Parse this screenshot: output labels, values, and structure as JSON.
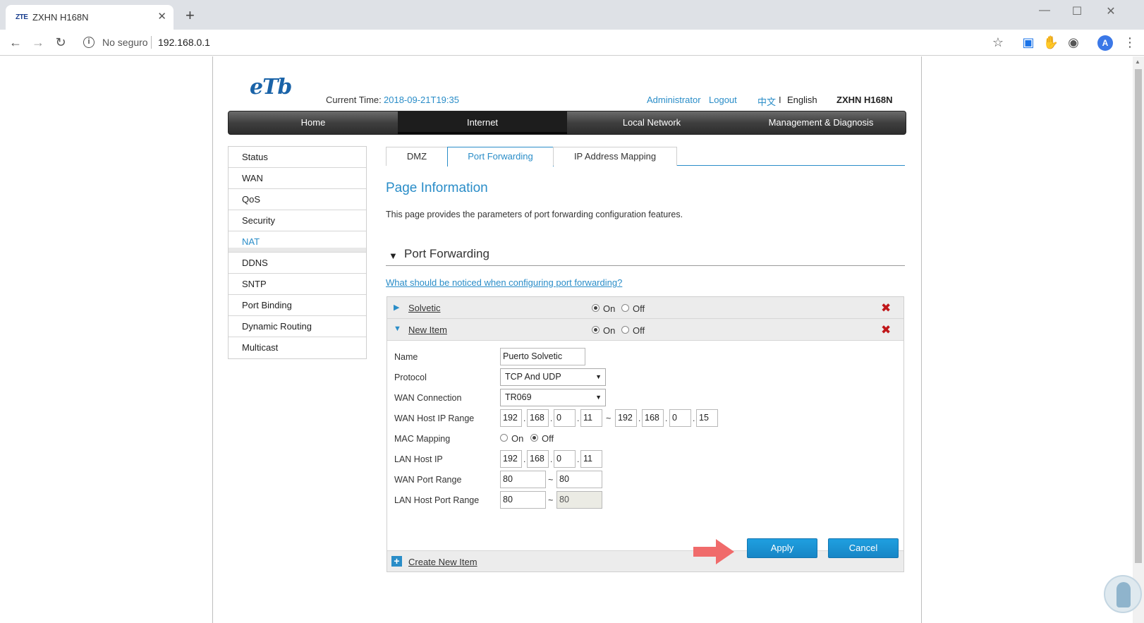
{
  "browser": {
    "tab_favicon": "ZTE",
    "tab_title": "ZXHN H168N",
    "not_secure": "No seguro",
    "url": "192.168.0.1",
    "avatar_letter": "A"
  },
  "header": {
    "logo_text": "eTb",
    "current_time_label": "Current Time:",
    "current_time_value": "2018-09-21T19:35",
    "admin_label": "Administrator",
    "logout_label": "Logout",
    "lang_cn": "中文",
    "lang_sep": "I",
    "lang_en": "English",
    "model": "ZXHN H168N"
  },
  "mainnav": [
    {
      "label": "Home"
    },
    {
      "label": "Internet"
    },
    {
      "label": "Local Network"
    },
    {
      "label": "Management & Diagnosis"
    }
  ],
  "sidemenu": [
    {
      "label": "Status"
    },
    {
      "label": "WAN"
    },
    {
      "label": "QoS"
    },
    {
      "label": "Security"
    },
    {
      "label": "NAT"
    },
    {
      "label": "DDNS"
    },
    {
      "label": "SNTP"
    },
    {
      "label": "Port Binding"
    },
    {
      "label": "Dynamic Routing"
    },
    {
      "label": "Multicast"
    }
  ],
  "subtabs": [
    {
      "label": "DMZ"
    },
    {
      "label": "Port Forwarding"
    },
    {
      "label": "IP Address Mapping"
    }
  ],
  "page": {
    "title": "Page Information",
    "description": "This page provides the parameters of port forwarding configuration features.",
    "section_title": "Port Forwarding",
    "notice_link": "What should be noticed when configuring port forwarding?"
  },
  "rules": [
    {
      "name": "Solvetic",
      "on_label": "On",
      "off_label": "Off"
    },
    {
      "name": "New Item",
      "on_label": "On",
      "off_label": "Off"
    }
  ],
  "form": {
    "name_label": "Name",
    "name_value": "Puerto Solvetic",
    "protocol_label": "Protocol",
    "protocol_value": "TCP And UDP",
    "wan_conn_label": "WAN Connection",
    "wan_conn_value": "TR069",
    "wan_ip_label": "WAN Host IP Range",
    "wan_ip_start": [
      "192",
      "168",
      "0",
      "11"
    ],
    "wan_ip_end": [
      "192",
      "168",
      "0",
      "15"
    ],
    "mac_label": "MAC Mapping",
    "mac_on": "On",
    "mac_off": "Off",
    "lan_ip_label": "LAN Host IP",
    "lan_ip": [
      "192",
      "168",
      "0",
      "11"
    ],
    "wan_port_label": "WAN Port Range",
    "wan_port_start": "80",
    "wan_port_end": "80",
    "lan_port_label": "LAN Host Port Range",
    "lan_port_start": "80",
    "lan_port_end": "80",
    "tilde": "~",
    "dot": "."
  },
  "buttons": {
    "apply": "Apply",
    "cancel": "Cancel",
    "create_new": "Create New Item"
  },
  "colors": {
    "accent": "#2a8dc8",
    "delete": "#c0171a",
    "arrow": "#f06b6b"
  }
}
